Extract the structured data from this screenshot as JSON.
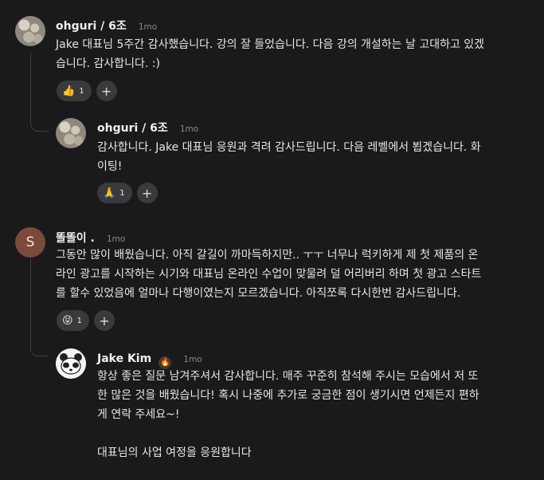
{
  "comments": [
    {
      "author": "ohguri / 6조",
      "time": "1mo",
      "lines": [
        "Jake 대표님 5주간 감사했습니다. 강의 잘 들었습니다. 다음 강의 개설하는 날 고대하고 있겠",
        "습니다. 감사합니다. :)"
      ],
      "reaction": {
        "emoji": "👍",
        "count": "1"
      },
      "add_label": "+"
    },
    {
      "author": "ohguri / 6조",
      "time": "1mo",
      "lines": [
        "감사합니다. Jake 대표님 응원과 격려 감사드립니다.  다음 레벨에서 뵙겠습니다. 화",
        "이팅!"
      ],
      "reaction": {
        "emoji": "🙏",
        "count": "1"
      },
      "add_label": "+"
    },
    {
      "author": "똘똘이 .",
      "avatar_letter": "S",
      "time": "1mo",
      "lines": [
        "그동안 많이 배웠습니다. 아직 갈길이 까마득하지만.. ㅜㅜ 너무나 럭키하게 제 첫 제품의 온",
        "라인 광고를 시작하는 시기와 대표님 온라인 수업이 맞물려 덜 어리버리 하며 첫 광고 스타트",
        "를 할수 있었음에 얼마나 다행이였는지 모르겠습니다. 아직쪼록 다시한번 감사드립니다."
      ],
      "reaction": {
        "emoji": "😝",
        "count": "1"
      },
      "add_label": "+"
    },
    {
      "author": "Jake Kim",
      "badge": "🔥",
      "time": "1mo",
      "lines": [
        "항상 좋은 질문 남겨주셔서 감사합니다. 매주 꾸준히 참석해 주시는 모습에서 저 또",
        "한 많은 것을 배웠습니다! 혹시 나중에 추가로 궁금한 점이 생기시면 언제든지 편하",
        "게 연락 주세요~!"
      ],
      "extra": "대표님의 사업 여정을 응원합니다"
    }
  ]
}
